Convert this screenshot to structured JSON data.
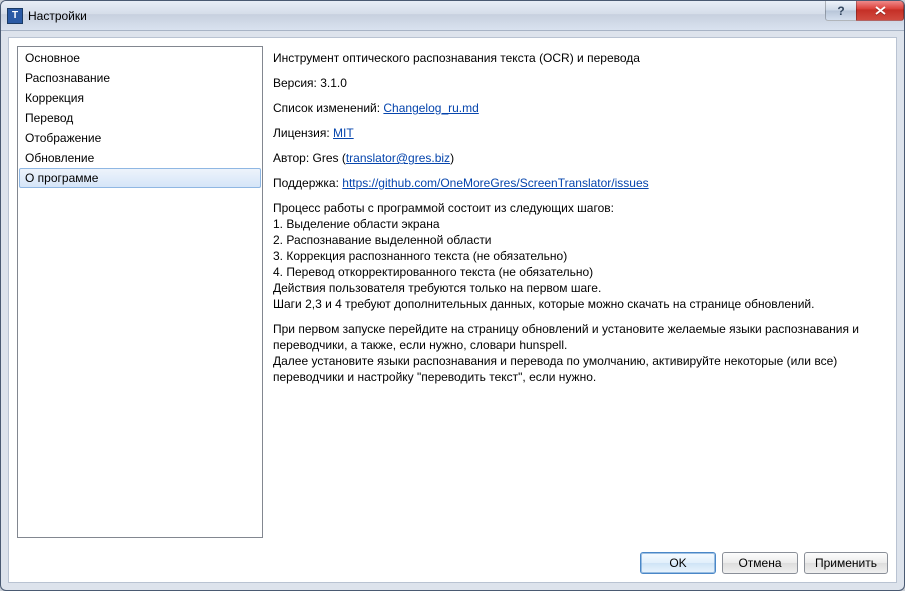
{
  "window": {
    "title": "Настройки",
    "app_icon_letter": "T"
  },
  "sidebar": {
    "items": [
      {
        "label": "Основное"
      },
      {
        "label": "Распознавание"
      },
      {
        "label": "Коррекция"
      },
      {
        "label": "Перевод"
      },
      {
        "label": "Отображение"
      },
      {
        "label": "Обновление"
      },
      {
        "label": "О программе",
        "selected": true
      }
    ]
  },
  "content": {
    "description": "Инструмент оптического распознавания текста (OCR) и перевода",
    "version_label": "Версия: ",
    "version_value": "3.1.0",
    "changelog_label": "Список изменений: ",
    "changelog_link": "Changelog_ru.md",
    "license_label": "Лицензия: ",
    "license_link": "MIT",
    "author_label": "Автор: Gres (",
    "author_link": "translator@gres.biz",
    "author_close": ")",
    "support_label": "Поддержка: ",
    "support_link": "https://github.com/OneMoreGres/ScreenTranslator/issues",
    "process_intro": "Процесс работы с программой состоит из следующих шагов:",
    "step1": "1. Выделение области экрана",
    "step2": "2. Распознавание выделенной области",
    "step3": "3. Коррекция распознанного текста (не обязательно)",
    "step4": "4. Перевод откорректированного текста (не обязательно)",
    "actions_note": "Действия пользователя требуются только на первом шаге.",
    "steps_note": "Шаги 2,3 и 4 требуют дополнительных данных, которые можно скачать на странице обновлений.",
    "first_run1": "При первом запуске перейдите на страницу обновлений и установите желаемые языки распознавания и переводчики, а также, если нужно, словари hunspell.",
    "first_run2": "Далее установите языки распознавания и перевода по умолчанию, активируйте некоторые (или все) переводчики и настройку \"переводить текст\", если нужно."
  },
  "buttons": {
    "ok": "OK",
    "cancel": "Отмена",
    "apply": "Применить"
  }
}
